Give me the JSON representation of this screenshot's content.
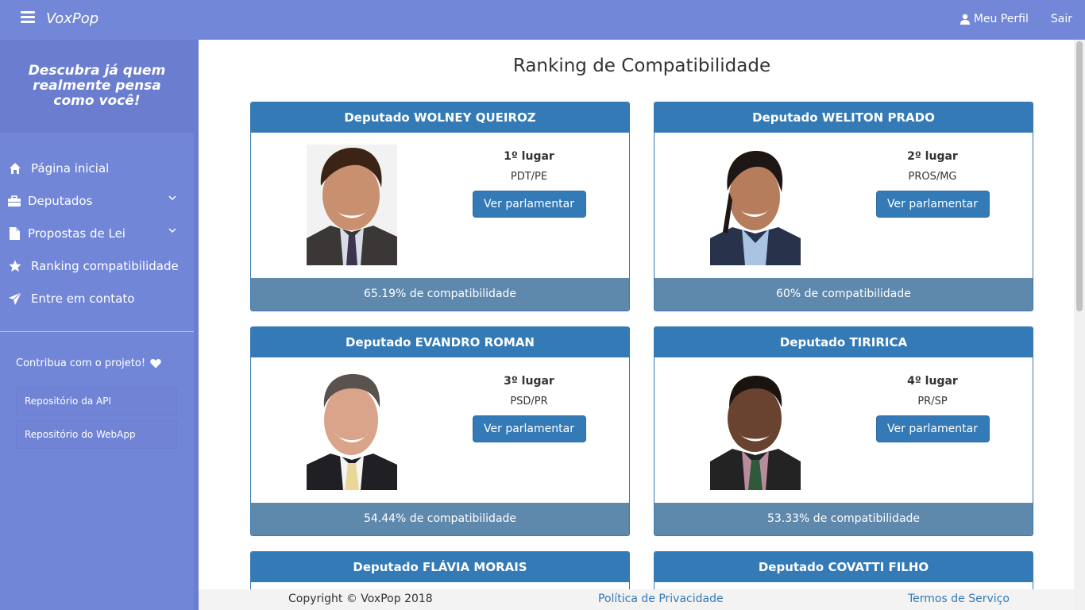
{
  "app": {
    "brand": "VoxPop"
  },
  "topnav": {
    "profile_label": "Meu Perfil",
    "logout_label": "Sair"
  },
  "sidebar": {
    "tagline": "Descubra já quem realmente pensa como você!",
    "items": [
      {
        "label": "Página inicial",
        "icon": "home-icon"
      },
      {
        "label": "Deputados",
        "icon": "briefcase-icon"
      },
      {
        "label": "Propostas de Lei",
        "icon": "file-icon"
      },
      {
        "label": "Ranking compatibilidade",
        "icon": "star-icon"
      },
      {
        "label": "Entre em contato",
        "icon": "send-icon"
      }
    ],
    "contribute": "Contribua com o projeto!",
    "repos": [
      "Repositório da API",
      "Repositório do WebApp"
    ]
  },
  "main": {
    "title": "Ranking de Compatibilidade",
    "button_label": "Ver parlamentar",
    "cards": [
      {
        "name": "Deputado WOLNEY QUEIROZ",
        "rank": "1º lugar",
        "party": "PDT/PE",
        "compat": "65.19% de compatibilidade"
      },
      {
        "name": "Deputado WELITON PRADO",
        "rank": "2º lugar",
        "party": "PROS/MG",
        "compat": "60% de compatibilidade"
      },
      {
        "name": "Deputado EVANDRO ROMAN",
        "rank": "3º lugar",
        "party": "PSD/PR",
        "compat": "54.44% de compatibilidade"
      },
      {
        "name": "Deputado TIRIRICA",
        "rank": "4º lugar",
        "party": "PR/SP",
        "compat": "53.33% de compatibilidade"
      },
      {
        "name": "Deputado FLÁVIA MORAIS"
      },
      {
        "name": "Deputado COVATTI FILHO"
      }
    ]
  },
  "footer": {
    "copyright": "Copyright © VoxPop 2018",
    "privacy": "Política de Privacidade",
    "terms": "Termos de Serviço"
  },
  "colors": {
    "navbar": "#7287d8",
    "primary": "#337ab7",
    "card_footer": "#5f88ad"
  }
}
